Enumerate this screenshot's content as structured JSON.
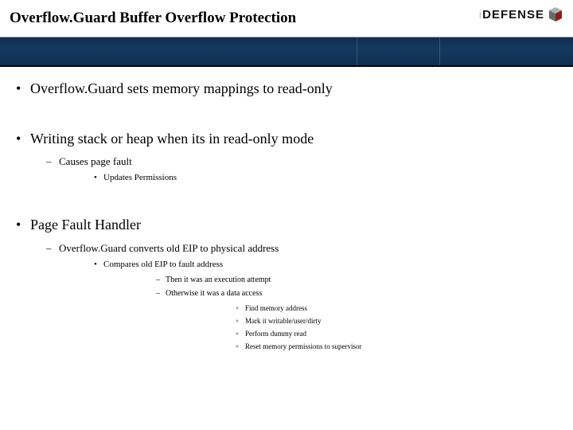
{
  "logo": {
    "text_light": "i",
    "text_bold": "DEFENSE"
  },
  "title": "Overflow.Guard Buffer Overflow Protection",
  "bullets": {
    "b1": "Overflow.Guard sets memory mappings to read-only",
    "b2": "Writing stack or heap when its in read-only mode",
    "b2_1": "Causes page fault",
    "b2_1_1": "Updates Permissions",
    "b3": "Page Fault Handler",
    "b3_1": "Overflow.Guard converts old EIP to physical address",
    "b3_1_1": "Compares old EIP to fault address",
    "b3_1_1_1": "Then it was an execution attempt",
    "b3_1_1_2": "Otherwise it was a data access",
    "b3_1_1_2_1": "Find memory address",
    "b3_1_1_2_2": "Mark it writable/user/dirty",
    "b3_1_1_2_3": "Perform dummy read",
    "b3_1_1_2_4": "Reset memory permissions to supervisor"
  }
}
